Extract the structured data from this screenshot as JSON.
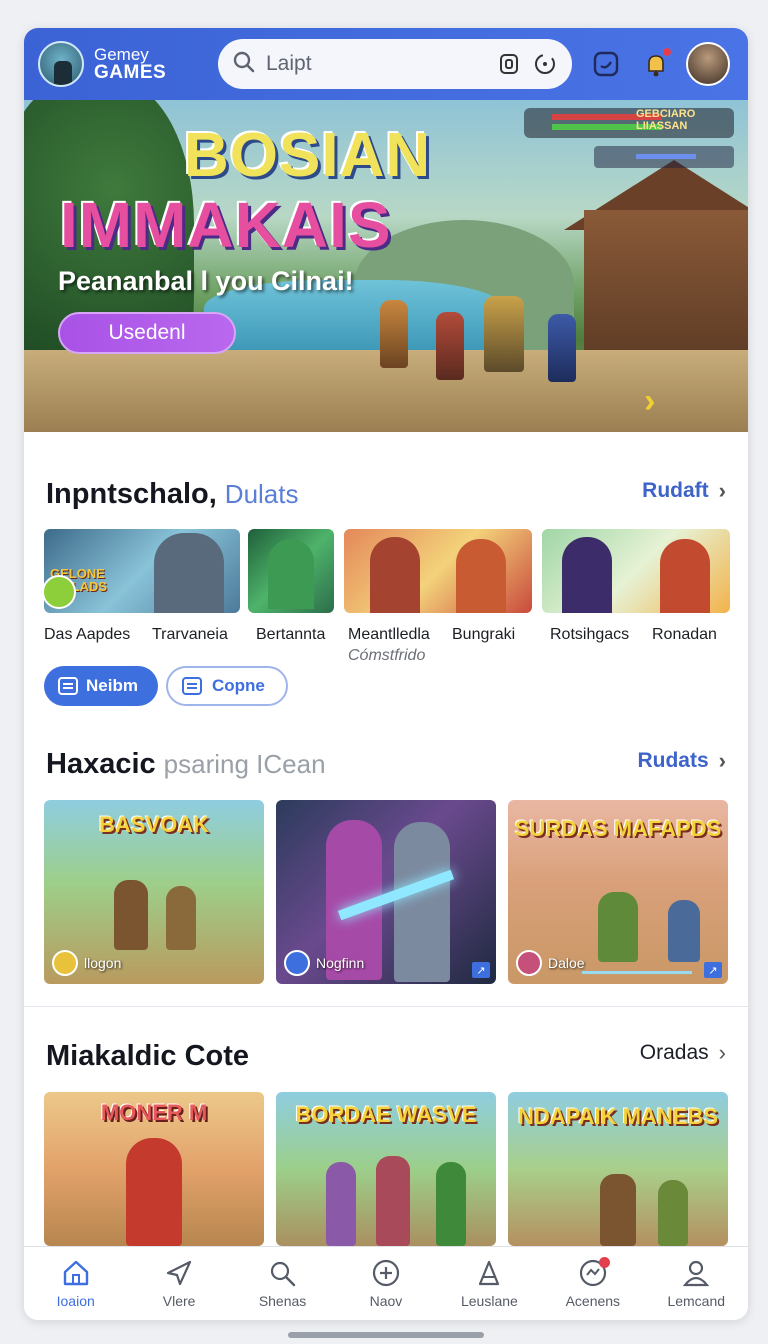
{
  "header": {
    "logo_line1": "Gemey",
    "logo_line2": "GAMES",
    "search_placeholder": "Laipt",
    "accent": "#3b63d6"
  },
  "hero": {
    "title_line1": "BOSIAN",
    "title_line2": "IMMAKAIS",
    "subtitle": "Peananbal l you Cilnai!",
    "cta_label": "Usedenl",
    "hud_text_1": "GEBCIARO",
    "hud_text_2": "LIIASSAN"
  },
  "section1": {
    "title": "Inpntschalo,",
    "subtitle": "Dulats",
    "link": "Rudaft",
    "games": [
      {
        "label": "Das Aapdes",
        "art": "GELONE IDELADS"
      },
      {
        "label": "Trarvaneia"
      },
      {
        "label": "Bertannta"
      },
      {
        "label": "Meantlledla",
        "sublabel": "Cómstfrido"
      },
      {
        "label": "Bungraki"
      },
      {
        "label": "Rotsihgacs"
      },
      {
        "label": "Ronadan"
      }
    ],
    "pill_primary": "Neibm",
    "pill_outline": "Copne"
  },
  "section2": {
    "title": "Haxacic",
    "subtitle": "psaring ICean",
    "link": "Rudats",
    "cards": [
      {
        "art_title": "BASVOAK",
        "footer": "llogon"
      },
      {
        "art_title": "",
        "footer": "Nogfinn"
      },
      {
        "art_title": "SURDAS MAFAPDS",
        "footer": "Daloe"
      }
    ]
  },
  "section3": {
    "title": "Miakaldic Cote",
    "link": "Oradas",
    "cards": [
      {
        "art_title": "MONER M"
      },
      {
        "art_title": "BORDAE WASVE"
      },
      {
        "art_title": "NDAPAIK MANEBS"
      }
    ]
  },
  "nav": {
    "items": [
      {
        "label": "Ioaion",
        "icon": "home-icon"
      },
      {
        "label": "Vlere",
        "icon": "send-icon"
      },
      {
        "label": "Shenas",
        "icon": "search-icon"
      },
      {
        "label": "Naov",
        "icon": "plus-circle-icon"
      },
      {
        "label": "Leuslane",
        "icon": "cone-icon"
      },
      {
        "label": "Acenens",
        "icon": "activity-icon"
      },
      {
        "label": "Lemcand",
        "icon": "profile-icon"
      }
    ]
  }
}
